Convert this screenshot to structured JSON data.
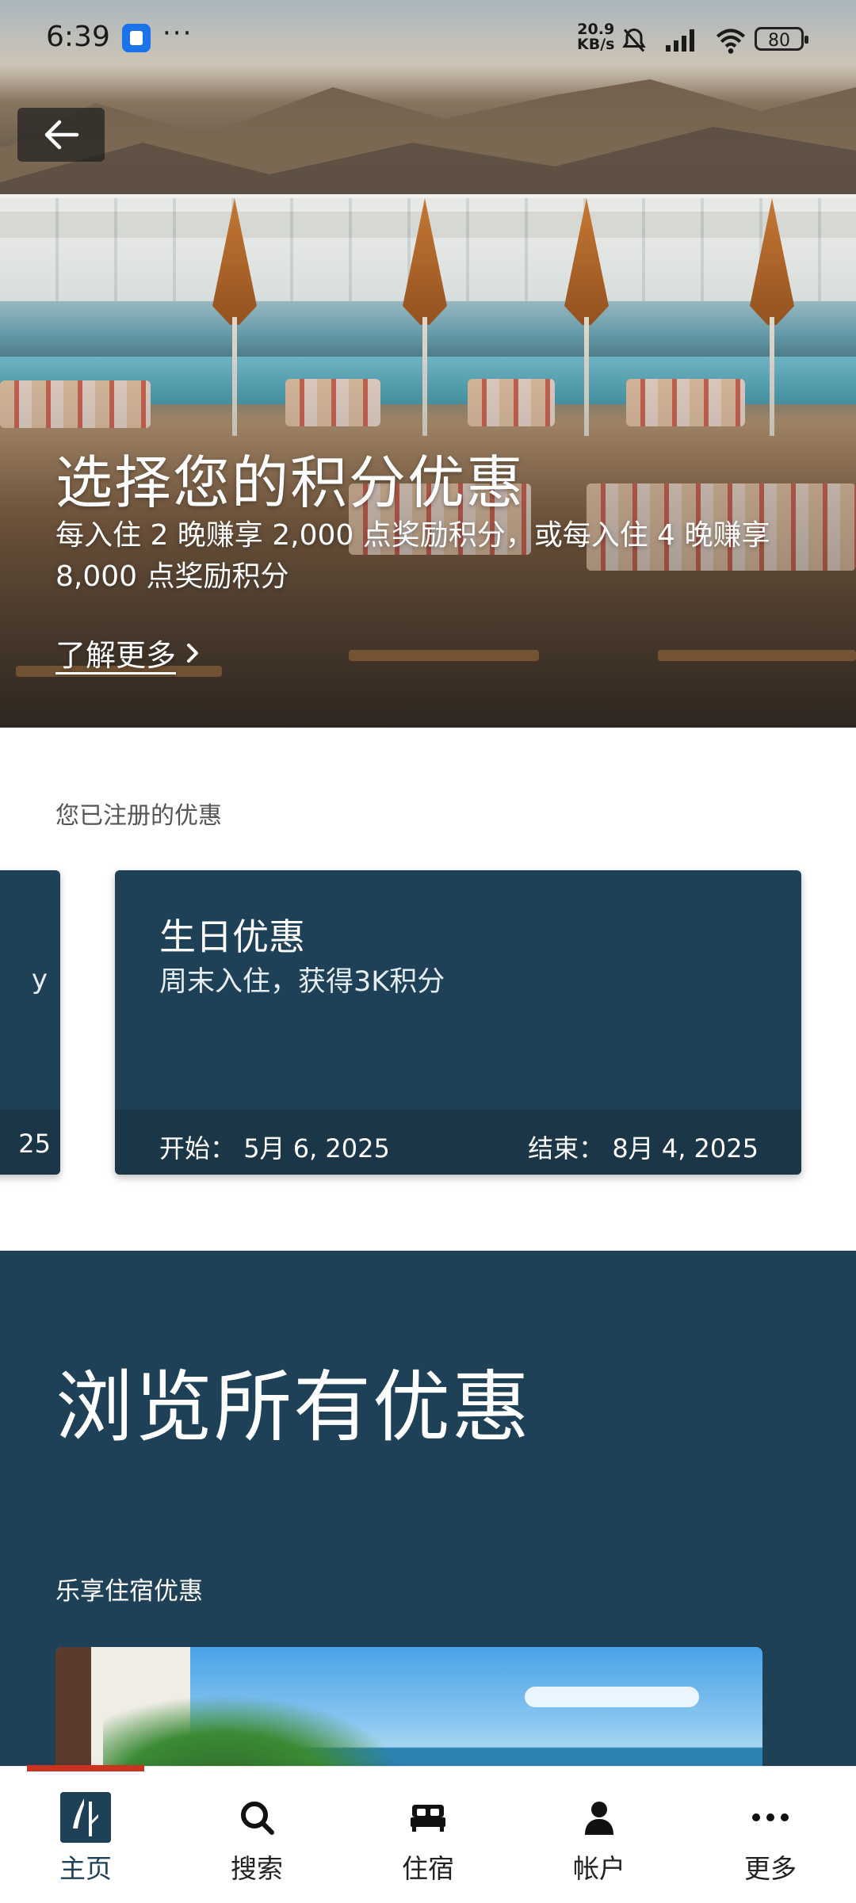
{
  "status_bar": {
    "time": "6:39",
    "more": "···",
    "speed_value": "20.9",
    "speed_unit": "KB/s",
    "battery": "80"
  },
  "hero": {
    "title": "选择您的积分优惠",
    "subtitle": "每入住 2 晚赚享 2,000 点奖励积分，或每入住 4 晚赚享 8,000 点奖励积分",
    "learn_more": "了解更多"
  },
  "registered": {
    "label": "您已注册的优惠",
    "prev_card": {
      "peek_text": "y",
      "peek_date": "25"
    },
    "card": {
      "title": "生日优惠",
      "description": "周末入住，获得3K积分",
      "start_label": "开始：",
      "start_date": "5月 6, 2025",
      "end_label": "结束：",
      "end_date": "8月 4, 2025"
    }
  },
  "browse": {
    "title": "浏览所有优惠",
    "subtitle": "乐享住宿优惠"
  },
  "nav": {
    "items": [
      {
        "label": "主页",
        "icon": "brand-logo-icon"
      },
      {
        "label": "搜索",
        "icon": "search-icon"
      },
      {
        "label": "住宿",
        "icon": "bed-icon"
      },
      {
        "label": "帐户",
        "icon": "person-icon"
      },
      {
        "label": "更多",
        "icon": "more-icon"
      }
    ]
  },
  "colors": {
    "brand_navy": "#1f4157",
    "active_indicator": "#c9331f"
  }
}
